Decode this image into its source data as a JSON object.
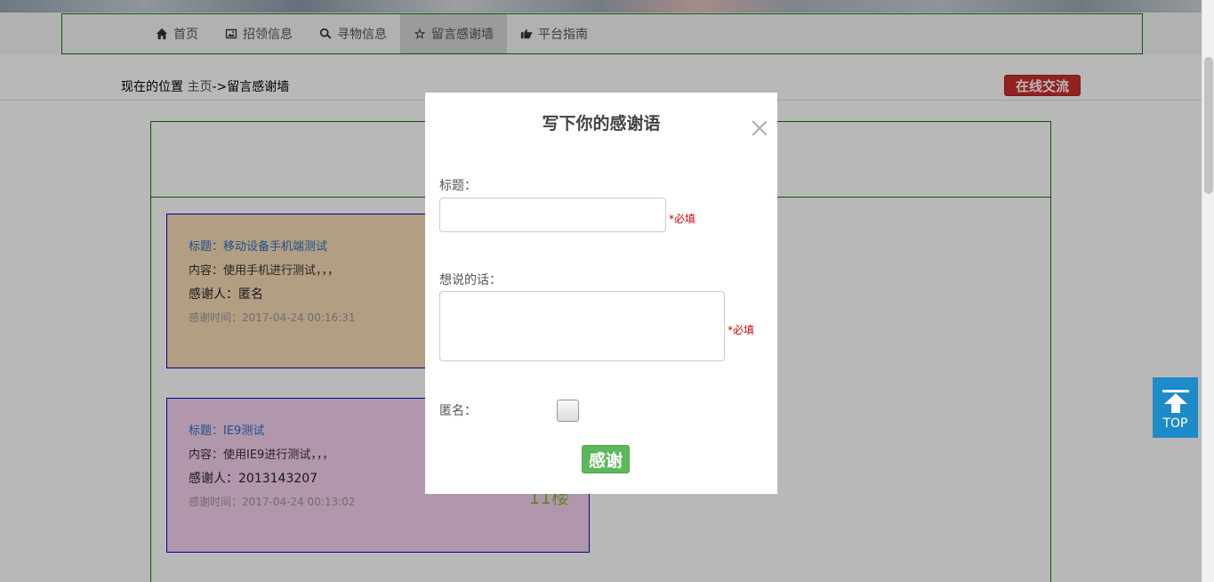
{
  "nav": {
    "items": [
      {
        "label": "首页",
        "icon": "home-icon",
        "active": false
      },
      {
        "label": "招领信息",
        "icon": "picture-icon",
        "active": false
      },
      {
        "label": "寻物信息",
        "icon": "search-icon",
        "active": false
      },
      {
        "label": "留言感谢墙",
        "icon": "star-icon",
        "active": true
      },
      {
        "label": "平台指南",
        "icon": "hand-pointing-icon",
        "active": false
      }
    ]
  },
  "breadcrumb": {
    "prefix": "现在的位置 ",
    "home": "主页",
    "separator": "->",
    "current": "留言感谢墙"
  },
  "chat_button": {
    "label": "在线交流"
  },
  "messages": [
    {
      "title": "标题：移动设备手机端测试",
      "content": "内容：使用手机进行测试，，，",
      "thanker": "感谢人：匿名",
      "time": "感谢时间：2017-04-24 00:16:31",
      "floor": "",
      "bg_color": "#f7dcb6"
    },
    {
      "title": "标题：IE9测试",
      "content": "内容：使用IE9进行测试，，，",
      "thanker": "感谢人：2013143207",
      "time": "感谢时间：2017-04-24 00:13:02",
      "floor": "11楼",
      "bg_color": "#f6d1ef"
    }
  ],
  "top_button": {
    "label": "TOP"
  },
  "modal": {
    "title": "写下你的感谢语",
    "title_label": "标题：",
    "title_value": "",
    "title_required": "*必填",
    "message_label": "想说的话：",
    "message_value": "",
    "message_required": "*必填",
    "anonymous_label": "匿名：",
    "anonymous_checked": false,
    "submit_label": "感谢"
  },
  "colors": {
    "accent_green": "#5cb85c",
    "chat_red": "#c9302c",
    "top_blue": "#1d8bc7",
    "required_red": "#dd0000"
  }
}
